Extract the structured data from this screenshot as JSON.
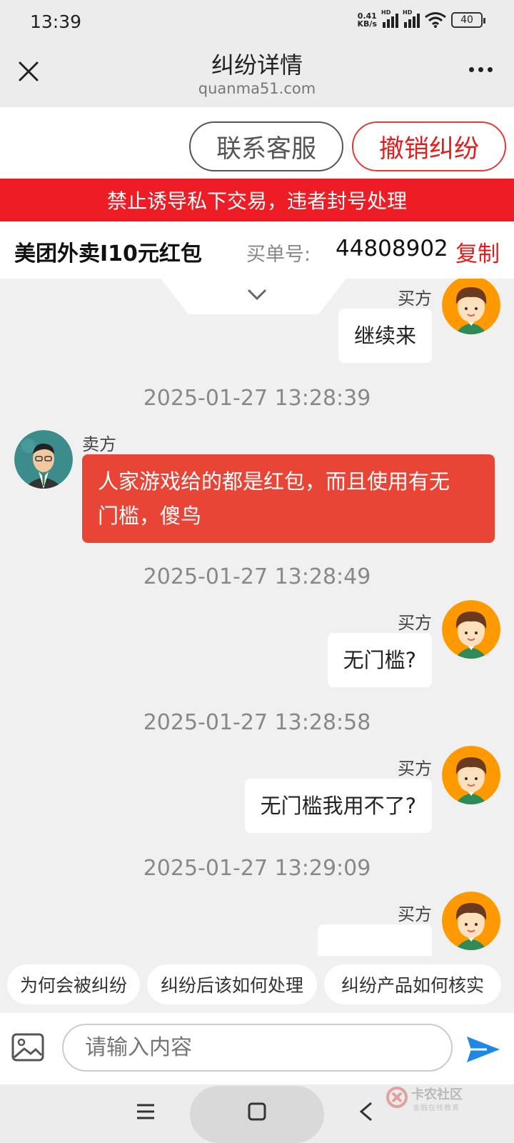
{
  "status_bar": {
    "time": "13:39",
    "net_speed_value": "0.41",
    "net_speed_unit": "KB/s",
    "signal_label_1": "HD",
    "signal_label_2": "HD",
    "battery": "40"
  },
  "header": {
    "title": "纠纷详情",
    "domain": "quanma51.com"
  },
  "actions": {
    "contact_label": "联系客服",
    "cancel_label": "撤销纠纷"
  },
  "warning": "禁止诱导私下交易，违者封号处理",
  "order": {
    "product": "美团外卖I10元红包",
    "number_label": "买单号:",
    "number": "44808902",
    "copy_label": "复制"
  },
  "chat": {
    "messages": [
      {
        "side": "right",
        "sender": "买方",
        "text": "继续来"
      },
      {
        "timestamp": "2025-01-27 13:28:39",
        "side": "left",
        "sender": "卖方",
        "text_line1": "人家游戏给的都是红包，而且使用有无",
        "text_line2": "门槛，傻鸟"
      },
      {
        "timestamp": "2025-01-27 13:28:49",
        "side": "right",
        "sender": "买方",
        "text": "无门槛?"
      },
      {
        "timestamp": "2025-01-27 13:28:58",
        "side": "right",
        "sender": "买方",
        "text": "无门槛我用不了?"
      },
      {
        "timestamp": "2025-01-27 13:29:09",
        "side": "right",
        "sender": "买方",
        "text": ""
      }
    ]
  },
  "quick_questions": [
    "为何会被纠纷",
    "纠纷后该如何处理",
    "纠纷产品如何核实"
  ],
  "input": {
    "placeholder": "请输入内容"
  },
  "watermark": {
    "name": "卡农社区",
    "tagline": "金融在线教育"
  },
  "colors": {
    "accent_red": "#ee1c25",
    "bubble_red": "#e94537",
    "send_blue": "#1e88e5"
  }
}
